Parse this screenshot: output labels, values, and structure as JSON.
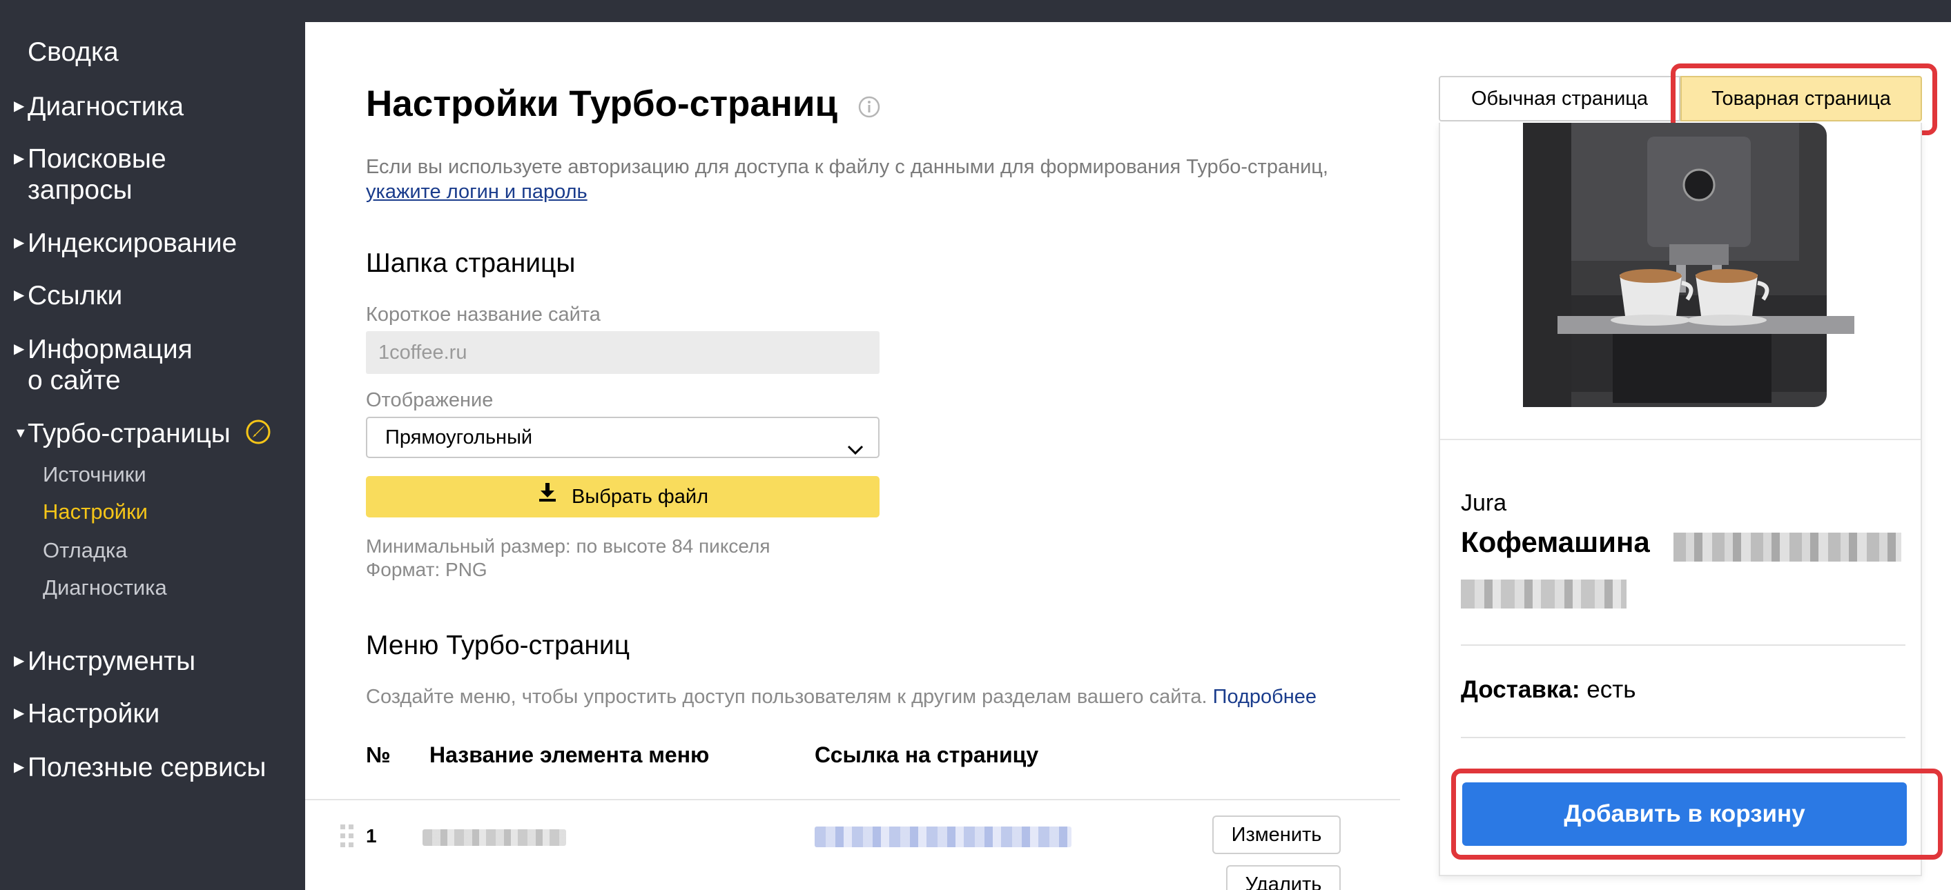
{
  "sidebar": {
    "top_item": "Сводка",
    "items": [
      {
        "label": "Диагностика"
      },
      {
        "label": "Поисковые\nзапросы"
      },
      {
        "label": "Индексирование"
      },
      {
        "label": "Ссылки"
      },
      {
        "label": "Информация\nо сайте"
      },
      {
        "label": "Турбо-страницы"
      },
      {
        "label": "Инструменты"
      },
      {
        "label": "Настройки"
      },
      {
        "label": "Полезные сервисы"
      }
    ],
    "turbo_sub": [
      {
        "label": "Источники"
      },
      {
        "label": "Настройки"
      },
      {
        "label": "Отладка"
      },
      {
        "label": "Диагностика"
      }
    ]
  },
  "main": {
    "title": "Настройки Турбо-страниц",
    "auth_note": "Если вы используете авторизацию для доступа к файлу с данными для формирования Турбо-страниц,",
    "auth_link": "укажите логин и пароль",
    "header_section": {
      "title": "Шапка страницы",
      "short_name_label": "Короткое название сайта",
      "short_name_value": "1coffee.ru",
      "display_label": "Отображение",
      "display_value": "Прямоугольный",
      "file_button": "Выбрать файл",
      "hint_size": "Минимальный размер: по высоте 84 пикселя",
      "hint_format": "Формат: PNG"
    },
    "menu_section": {
      "title": "Меню Турбо-страниц",
      "description": "Создайте меню, чтобы упростить доступ пользователям к другим разделам вашего сайта.",
      "more_link": "Подробнее",
      "columns": [
        "№",
        "Название элемента меню",
        "Ссылка на страницу"
      ],
      "rows": [
        {
          "num": "1",
          "edit": "Изменить",
          "delete": "Удалить"
        }
      ]
    }
  },
  "preview": {
    "tabs": [
      "Обычная страница",
      "Товарная страница"
    ],
    "active_tab": 1,
    "brand": "Jura",
    "product_title": "Кофемашина",
    "delivery_label": "Доставка:",
    "delivery_value": "есть",
    "cart_button": "Добавить в корзину"
  },
  "colors": {
    "sidebar_bg": "#2f323b",
    "active_sub": "#f5c518",
    "file_button": "#f9dc5c",
    "cart_button": "#2b79e4",
    "highlight": "#e0363a",
    "link": "#1a3c8c"
  },
  "icons": [
    "info-icon",
    "rocket-icon",
    "chevron-down-icon",
    "download-icon",
    "drag-handle-icon"
  ]
}
